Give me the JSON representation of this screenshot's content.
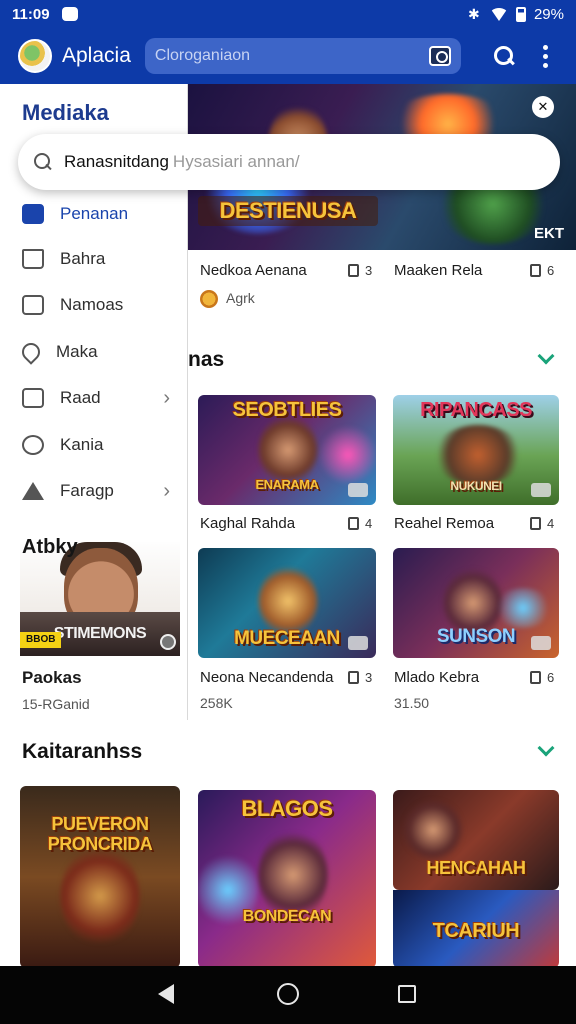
{
  "status": {
    "time": "11:09",
    "battery": "29%"
  },
  "app_bar": {
    "title": "Aplacia",
    "search_placeholder": "Cloroganiaon"
  },
  "search_overlay": {
    "query": "Ranasnitdang",
    "placeholder": "Hysasiari annan/"
  },
  "drawer": {
    "title": "Mediaka",
    "items": [
      {
        "label": "Penanan",
        "icon": "checkbox-icon",
        "active": true,
        "has_submenu": false
      },
      {
        "label": "Bahra",
        "icon": "house-icon",
        "active": false,
        "has_submenu": false
      },
      {
        "label": "Namoas",
        "icon": "mail-icon",
        "active": false,
        "has_submenu": false
      },
      {
        "label": "Maka",
        "icon": "pin-icon",
        "active": false,
        "has_submenu": false
      },
      {
        "label": "Raad",
        "icon": "list-icon",
        "active": false,
        "has_submenu": true
      },
      {
        "label": "Kania",
        "icon": "help-icon",
        "active": false,
        "has_submenu": false
      },
      {
        "label": "Faragp",
        "icon": "triangle-icon",
        "active": false,
        "has_submenu": true
      }
    ],
    "section": "Atbky",
    "profile": {
      "banner": "STIMEMONS",
      "tag": "BBOB",
      "name": "Paokas",
      "subtitle": "15-RGanid"
    }
  },
  "top_row": {
    "banner_logo": "DESTIENUSA",
    "banner_corner": "EKT",
    "items": [
      {
        "title": "Nedkoa Aenana",
        "count": "3",
        "sub": "Agrk"
      },
      {
        "title": "Maaken Rela",
        "count": "6"
      }
    ]
  },
  "sections": [
    {
      "title": "nas",
      "cards": [
        {
          "logo": "SEOBTLIES",
          "sub_logo": "ENARAMA",
          "title": "Kaghal Rahda",
          "count": "4"
        },
        {
          "logo": "RIPANCASS",
          "sub_logo": "NUKUNEI",
          "title": "Reahel Remoa",
          "count": "4"
        },
        {
          "logo": "MUECEAAN",
          "title": "Neona Necandenda",
          "count": "3",
          "sub": "258K"
        },
        {
          "logo": "SUNSON",
          "title": "Mlado Kebra",
          "count": "6",
          "sub": "31.50"
        }
      ]
    },
    {
      "title": "Kaitaranhss",
      "cards": [
        {
          "logo": "PUEVERON PRONCRIDA"
        },
        {
          "logo": "BLAGOS",
          "sub_logo": "BONDECAN"
        },
        {
          "logo": "HENCAHAH",
          "sub_logo": "TCARIUH"
        }
      ]
    }
  ],
  "colors": {
    "primary": "#0d3aa8",
    "accent": "#1aa37a"
  }
}
